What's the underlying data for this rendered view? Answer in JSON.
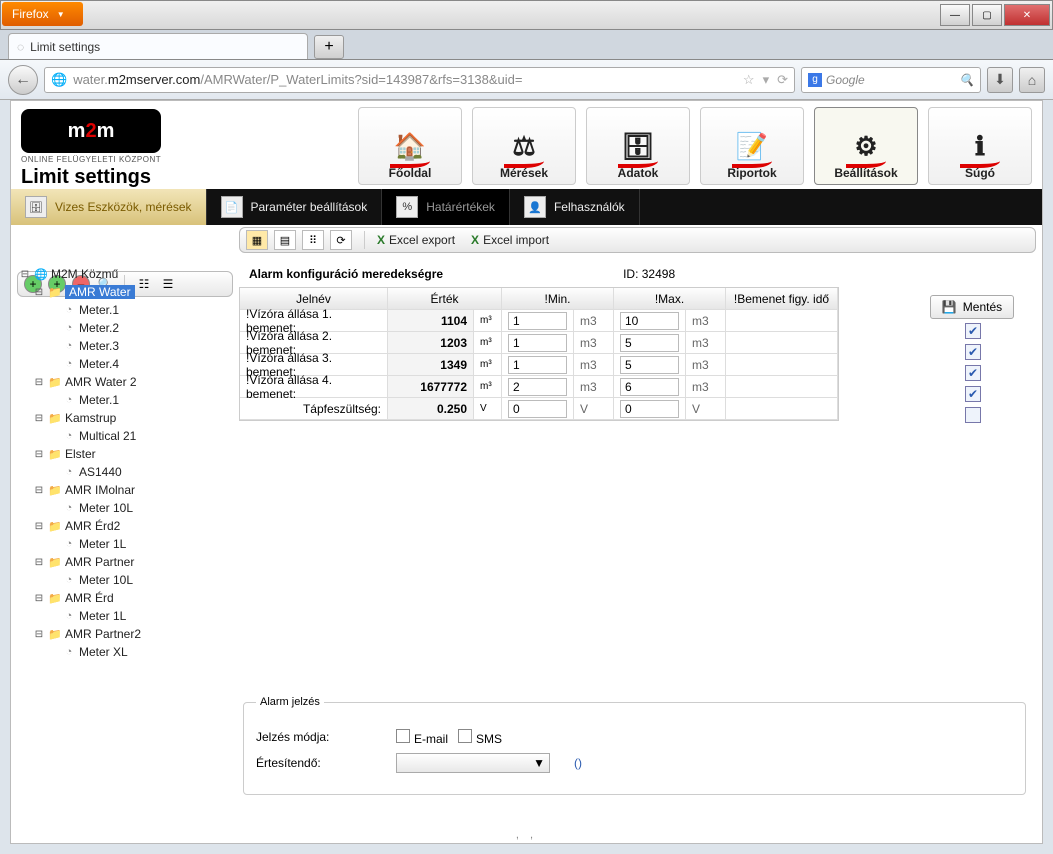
{
  "window": {
    "firefox_label": "Firefox",
    "tab_title": "Limit settings"
  },
  "url": {
    "pre_domain": "water.",
    "domain": "m2mserver.com",
    "path": "/AMRWater/P_WaterLimits?sid=143987&rfs=3138&uid=",
    "search_placeholder": "Google",
    "search_engine": "g"
  },
  "app": {
    "logo_sub": "ONLINE FELÜGYELETI KÖZPONT",
    "title": "Limit settings"
  },
  "nav": {
    "items": [
      {
        "label": "Főoldal",
        "icon": "🏠"
      },
      {
        "label": "Mérések",
        "icon": "⚖"
      },
      {
        "label": "Adatok",
        "icon": "🗄"
      },
      {
        "label": "Riportok",
        "icon": "📝"
      },
      {
        "label": "Beállítások",
        "icon": "⚙"
      },
      {
        "label": "Súgó",
        "icon": "ℹ"
      }
    ]
  },
  "subnav": {
    "items": [
      {
        "label": "Vizes Eszközök, mérések"
      },
      {
        "label": "Paraméter beállítások"
      },
      {
        "label": "Határértékek"
      },
      {
        "label": "Felhasználók"
      }
    ]
  },
  "actions": {
    "excel_export": "Excel export",
    "excel_import": "Excel import",
    "save": "Mentés"
  },
  "tree": {
    "root": "M2M Közmű",
    "n0": "AMR Water",
    "n0c": [
      "Meter.1",
      "Meter.2",
      "Meter.3",
      "Meter.4"
    ],
    "n1": "AMR Water 2",
    "n1c": [
      "Meter.1"
    ],
    "n2": "Kamstrup",
    "n2c": [
      "Multical 21"
    ],
    "n3": "Elster",
    "n3c": [
      "AS1440"
    ],
    "n4": "AMR IMolnar",
    "n4c": [
      "Meter 10L"
    ],
    "n5": "AMR Érd2",
    "n5c": [
      "Meter 1L"
    ],
    "n6": "AMR Partner",
    "n6c": [
      "Meter 10L"
    ],
    "n7": "AMR Érd",
    "n7c": [
      "Meter 1L"
    ],
    "n8": "AMR Partner2",
    "n8c": [
      "Meter XL"
    ]
  },
  "table": {
    "title": "Alarm konfiguráció meredekségre",
    "id_label": "ID: 32498",
    "headers": {
      "name": "Jelnév",
      "value": "Érték",
      "min": "!Min.",
      "max": "!Max.",
      "bem": "!Bemenet figy. idő"
    },
    "rows": [
      {
        "name": "!Vízóra állása 1. bemenet:",
        "value": "1104",
        "unit": "m³",
        "min": "1",
        "minu": "m3",
        "max": "10",
        "maxu": "m3",
        "chk": true
      },
      {
        "name": "!Vízóra állása 2. bemenet:",
        "value": "1203",
        "unit": "m³",
        "min": "1",
        "minu": "m3",
        "max": "5",
        "maxu": "m3",
        "chk": true
      },
      {
        "name": "!Vízóra állása 3. bemenet:",
        "value": "1349",
        "unit": "m³",
        "min": "1",
        "minu": "m3",
        "max": "5",
        "maxu": "m3",
        "chk": true
      },
      {
        "name": "!Vízóra állása 4. bemenet:",
        "value": "1677772",
        "unit": "m³",
        "min": "2",
        "minu": "m3",
        "max": "6",
        "maxu": "m3",
        "chk": true
      },
      {
        "name": "Tápfeszültség:",
        "value": "0.250",
        "unit": "V",
        "min": "0",
        "minu": "V",
        "max": "0",
        "maxu": "V",
        "chk": false
      }
    ]
  },
  "alarmset": {
    "legend": "Alarm jelzés",
    "mode_label": "Jelzés módja:",
    "email": "E-mail",
    "sms": "SMS",
    "notify_label": "Értesítendő:",
    "paren": "()"
  }
}
